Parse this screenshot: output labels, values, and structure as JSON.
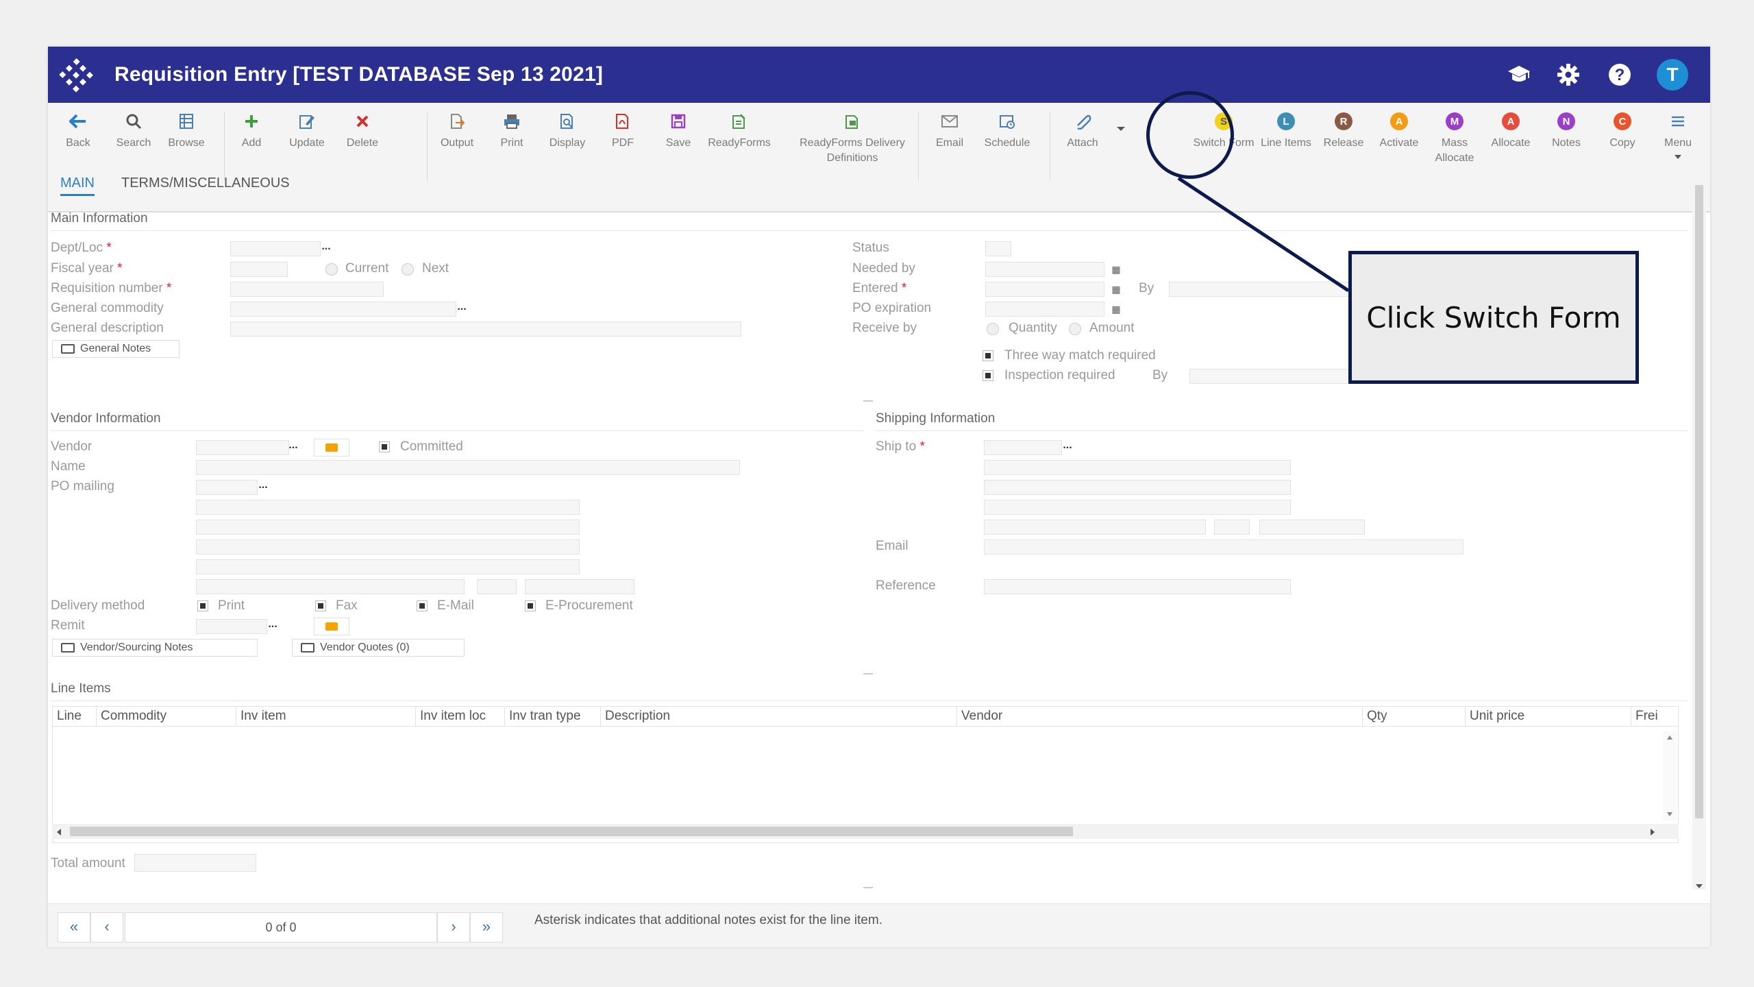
{
  "window": {
    "title": "Requisition Entry [TEST DATABASE Sep 13 2021]",
    "avatar_letter": "T"
  },
  "toolbar": [
    {
      "label": "Back"
    },
    {
      "label": "Search"
    },
    {
      "label": "Browse"
    },
    {
      "label": "Add"
    },
    {
      "label": "Update"
    },
    {
      "label": "Delete"
    },
    {
      "label": "Output"
    },
    {
      "label": "Print"
    },
    {
      "label": "Display"
    },
    {
      "label": "PDF"
    },
    {
      "label": "Save"
    },
    {
      "label": "ReadyForms"
    },
    {
      "label": "ReadyForms Delivery Definitions"
    },
    {
      "label": "Email"
    },
    {
      "label": "Schedule"
    },
    {
      "label": "Attach"
    },
    {
      "label": "Switch Form",
      "letter": "S",
      "color": "#f2d21b"
    },
    {
      "label": "Line Items",
      "letter": "L",
      "color": "#3d8fb5"
    },
    {
      "label": "Release",
      "letter": "R",
      "color": "#8a5a44"
    },
    {
      "label": "Activate",
      "letter": "A",
      "color": "#f39c12"
    },
    {
      "label": "Mass Allocate",
      "letter": "M",
      "color": "#9b3fc4"
    },
    {
      "label": "Allocate",
      "letter": "A",
      "color": "#e84c3d"
    },
    {
      "label": "Notes",
      "letter": "N",
      "color": "#9b3fc4"
    },
    {
      "label": "Copy",
      "letter": "C",
      "color": "#e8542b"
    },
    {
      "label": "Menu"
    }
  ],
  "tabs": {
    "main": "MAIN",
    "terms": "TERMS/MISCELLANEOUS"
  },
  "main_info": {
    "section": "Main Information",
    "dept_loc": "Dept/Loc",
    "fiscal_year": "Fiscal year",
    "current": "Current",
    "next": "Next",
    "req_number": "Requisition number",
    "gen_commodity": "General commodity",
    "gen_description": "General description",
    "general_notes": "General Notes",
    "status": "Status",
    "needed_by": "Needed by",
    "entered": "Entered",
    "by": "By",
    "po_expiration": "PO expiration",
    "receive_by": "Receive by",
    "quantity": "Quantity",
    "amount": "Amount",
    "three_way": "Three way match required",
    "inspection": "Inspection required",
    "by2": "By"
  },
  "vendor_info": {
    "section": "Vendor Information",
    "vendor": "Vendor",
    "committed": "Committed",
    "name": "Name",
    "po_mailing": "PO mailing",
    "delivery_method": "Delivery method",
    "print": "Print",
    "fax": "Fax",
    "email": "E-Mail",
    "eproc": "E-Procurement",
    "remit": "Remit",
    "sourcing_notes": "Vendor/Sourcing Notes",
    "vendor_quotes": "Vendor Quotes (0)"
  },
  "shipping_info": {
    "section": "Shipping Information",
    "ship_to": "Ship to",
    "email": "Email",
    "reference": "Reference"
  },
  "line_items": {
    "section": "Line Items",
    "columns": [
      "Line",
      "Commodity",
      "Inv item",
      "Inv item loc",
      "Inv tran type",
      "Description",
      "Vendor",
      "Qty",
      "Unit price",
      "Frei"
    ],
    "total_amount": "Total amount"
  },
  "footer": {
    "page_count": "0 of 0",
    "note": "Asterisk indicates that additional notes exist for the line item."
  },
  "callout": {
    "text": "Click Switch Form"
  }
}
